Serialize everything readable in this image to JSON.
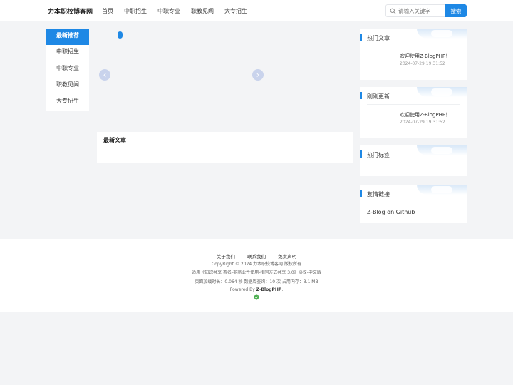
{
  "header": {
    "site_title": "力本职校博客网",
    "nav": [
      "首页",
      "中职招生",
      "中职专业",
      "职教见闻",
      "大专招生"
    ],
    "search_placeholder": "请输入关键字",
    "search_button": "搜索"
  },
  "sidebar": {
    "items": [
      "最新推荐",
      "中职招生",
      "中职专业",
      "职教见闻",
      "大专招生"
    ],
    "active_index": 0
  },
  "slider": {
    "prev_glyph": "‹",
    "next_glyph": "›"
  },
  "latest": {
    "title": "最新文章"
  },
  "widgets": {
    "hot_posts": {
      "title": "热门文章",
      "post_title": "欢迎使用Z-BlogPHP！",
      "post_date": "2024-07-29 19:31:52"
    },
    "recent": {
      "title": "刚刚更新",
      "post_title": "欢迎使用Z-BlogPHP！",
      "post_date": "2024-07-29 19:31:52"
    },
    "hot_tags": {
      "title": "热门标签"
    },
    "friend_links": {
      "title": "友情链接",
      "link": "Z-Blog on Github"
    }
  },
  "footer": {
    "links": [
      "关于我们",
      "联系我们",
      "免责声明"
    ],
    "copyright": "CopyRight © 2024 力本职校博客网 版权所有",
    "license": "适用《知识共享 署名-非商业性使用-相同方式共享 3.0》协议-中文版",
    "stats": "页面加载时长：0.064 秒 数据库查询：10 次 占用内存：3.1 MB",
    "powered_prefix": "Powered By ",
    "powered_name": "Z-BlogPHP",
    "powered_suffix": "."
  },
  "colors": {
    "accent": "#1e88e5",
    "background": "#f3f4f6",
    "shield": "#4caf50"
  }
}
